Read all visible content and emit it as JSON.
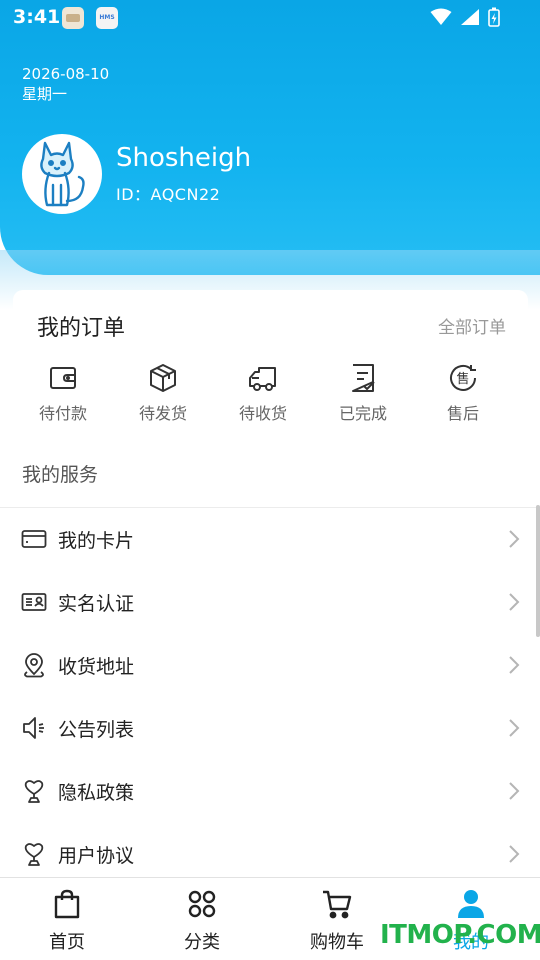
{
  "status_bar": {
    "time": "3:41",
    "notif_2_text": "HMS"
  },
  "header": {
    "date": "2026-08-10",
    "weekday": "星期一",
    "username": "Shosheigh",
    "user_id": "ID：AQCN22"
  },
  "orders": {
    "title": "我的订单",
    "all_link": "全部订单",
    "items": [
      {
        "label": "待付款",
        "icon": "wallet-icon"
      },
      {
        "label": "待发货",
        "icon": "package-icon"
      },
      {
        "label": "待收货",
        "icon": "truck-icon"
      },
      {
        "label": "已完成",
        "icon": "checklist-icon"
      },
      {
        "label": "售后",
        "icon": "after-sale-icon"
      }
    ]
  },
  "services": {
    "title": "我的服务",
    "items": [
      {
        "label": "我的卡片",
        "icon": "card-icon"
      },
      {
        "label": "实名认证",
        "icon": "id-card-icon"
      },
      {
        "label": "收货地址",
        "icon": "location-pin-icon"
      },
      {
        "label": "公告列表",
        "icon": "speaker-icon"
      },
      {
        "label": "隐私政策",
        "icon": "heart-trophy-icon"
      },
      {
        "label": "用户协议",
        "icon": "heart-trophy-icon"
      }
    ]
  },
  "bottom_nav": {
    "items": [
      {
        "label": "首页",
        "icon": "shopping-bag-icon"
      },
      {
        "label": "分类",
        "icon": "grid-circles-icon"
      },
      {
        "label": "购物车",
        "icon": "cart-icon"
      },
      {
        "label": "我的",
        "icon": "user-icon",
        "active": true
      }
    ]
  },
  "watermark": "ITMOP.COM",
  "colors": {
    "primary": "#0aa6e6",
    "watermark": "#22b24c"
  }
}
